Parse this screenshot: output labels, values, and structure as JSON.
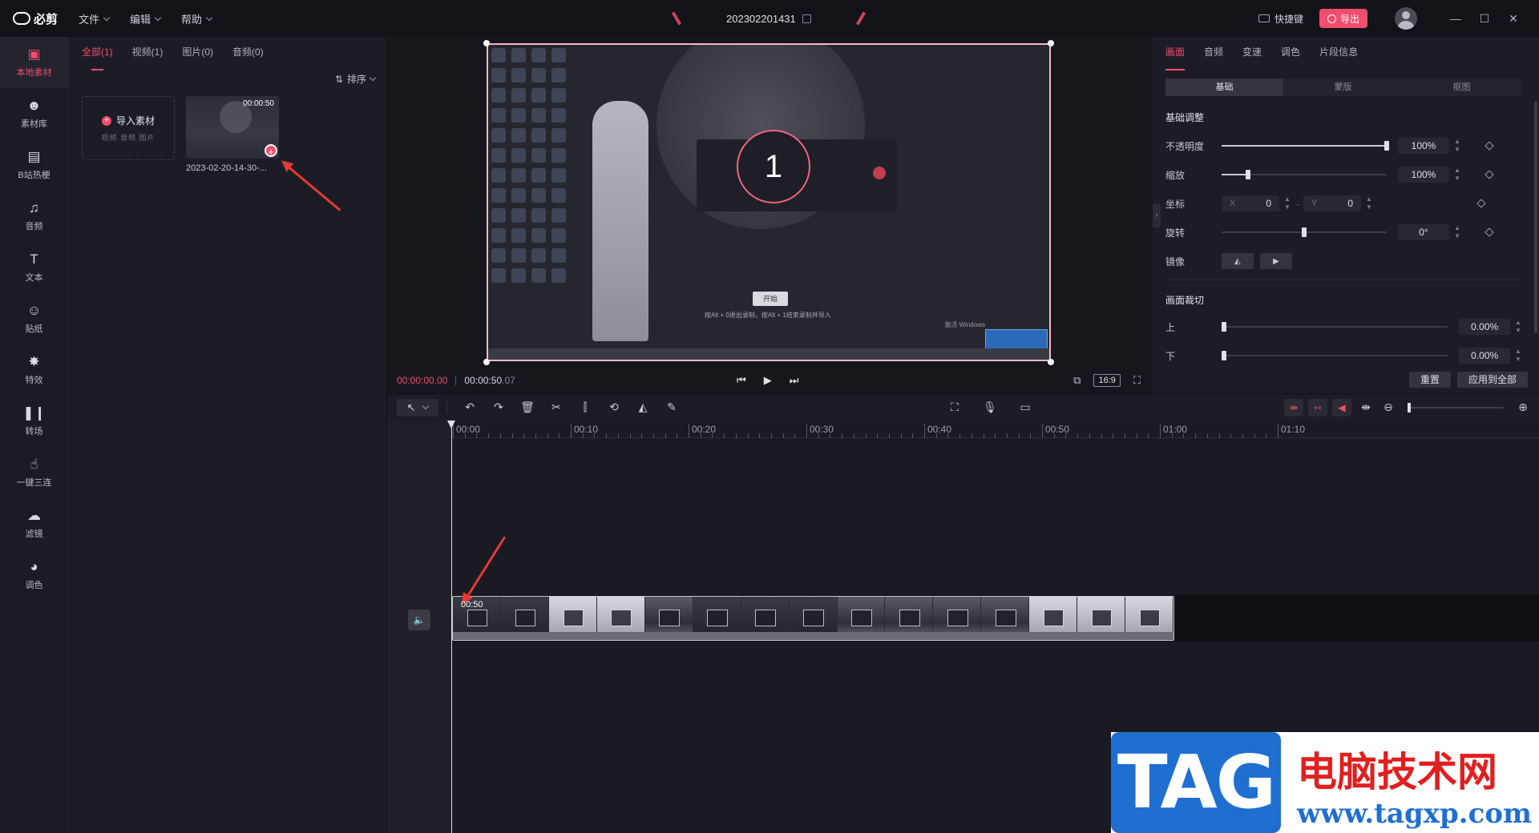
{
  "app": {
    "title": "必剪",
    "doc_title": "202302201431"
  },
  "menu": [
    "文件",
    "编辑",
    "帮助"
  ],
  "titlebar": {
    "shortcut": "快捷键",
    "export": "导出",
    "minimize": "—",
    "maximize": "☐",
    "close": "✕"
  },
  "rail": [
    {
      "label": "本地素材",
      "icon": "folder-icon",
      "glyph": "▣",
      "active": true
    },
    {
      "label": "素材库",
      "icon": "library-icon",
      "glyph": "☻",
      "active": false
    },
    {
      "label": "B站热梗",
      "icon": "bilibili-icon",
      "glyph": "▤",
      "active": false
    },
    {
      "label": "音频",
      "icon": "music-icon",
      "glyph": "♫",
      "active": false
    },
    {
      "label": "文本",
      "icon": "text-icon",
      "glyph": "T",
      "active": false
    },
    {
      "label": "贴纸",
      "icon": "sticker-icon",
      "glyph": "☺",
      "active": false
    },
    {
      "label": "特效",
      "icon": "effects-icon",
      "glyph": "✸",
      "active": false
    },
    {
      "label": "转场",
      "icon": "transition-icon",
      "glyph": "❚❙",
      "active": false
    },
    {
      "label": "一键三连",
      "icon": "thumbs-up-icon",
      "glyph": "☝",
      "active": false
    },
    {
      "label": "滤镜",
      "icon": "filter-icon",
      "glyph": "☁",
      "active": false
    },
    {
      "label": "调色",
      "icon": "palette-icon",
      "glyph": "◕",
      "active": false
    }
  ],
  "media": {
    "tabs": [
      "全部(1)",
      "视频(1)",
      "图片(0)",
      "音频(0)"
    ],
    "sort": "排序",
    "import_label": "导入素材",
    "import_sub": "视频 音频 图片",
    "clip_duration": "00:00:50",
    "clip_name": "2023-02-20-14-30-..."
  },
  "preview": {
    "countdown": "1",
    "start": "开始",
    "hint": "按Alt + 0退出录制，按Alt + 1结束录制并导入",
    "activate": "激活 Windows",
    "time_current": "00:00:00.00",
    "time_total": "00:00:50",
    "time_total_frac": ".07",
    "ratio": "16:9"
  },
  "props": {
    "tabs": [
      "画面",
      "音频",
      "变速",
      "调色",
      "片段信息"
    ],
    "segments": [
      "基础",
      "蒙版",
      "抠图"
    ],
    "basic_title": "基础调整",
    "opacity_label": "不透明度",
    "opacity_value": "100%",
    "opacity_level": 1.0,
    "scale_label": "缩放",
    "scale_value": "100%",
    "scale_level": 0.16,
    "position_label": "坐标",
    "x_label": "X",
    "x_value": "0",
    "y_label": "Y",
    "y_value": "0",
    "rotate_label": "旋转",
    "rotate_value": "0°",
    "rotate_level": 0.5,
    "mirror_label": "镜像",
    "crop_title": "画面裁切",
    "crop_top_label": "上",
    "crop_top_value": "0.00%",
    "crop_bottom_label": "下",
    "crop_bottom_value": "0.00%",
    "reset": "重置",
    "apply_all": "应用到全部"
  },
  "timeline": {
    "ticks": [
      "00:00",
      "00:10",
      "00:20",
      "00:30",
      "00:40",
      "00:50",
      "01:00",
      "01:10"
    ],
    "clip_duration": "00:50"
  },
  "watermark": {
    "tag": "TAG",
    "cn": "电脑技术网",
    "url": "www.tagxp.com"
  },
  "colors": {
    "accent": "#f24c6e",
    "arrow": "#e53935",
    "watermark_blue": "#1f6fd1",
    "watermark_red": "#e02020"
  }
}
